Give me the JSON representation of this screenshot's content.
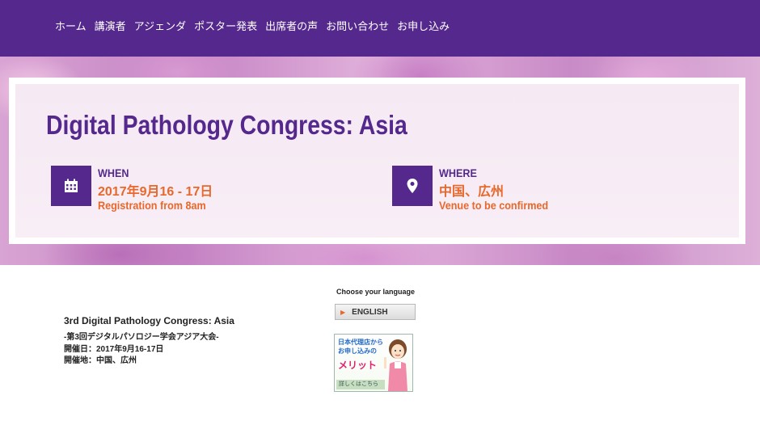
{
  "nav": {
    "items": [
      {
        "label": "ホーム"
      },
      {
        "label": "講演者"
      },
      {
        "label": "アジェンダ"
      },
      {
        "label": "ポスター発表"
      },
      {
        "label": "出席者の声"
      },
      {
        "label": "お問い合わせ"
      },
      {
        "label": "お申し込み"
      }
    ]
  },
  "hero": {
    "title": "Digital Pathology Congress: Asia",
    "when": {
      "label": "WHEN",
      "date": "2017年9月16 - 17日",
      "sub": "Registration from 8am",
      "icon": "calendar-icon"
    },
    "where": {
      "label": "WHERE",
      "place": "中国、広州",
      "sub": "Venue to be confirmed",
      "icon": "map-pin-icon"
    }
  },
  "content": {
    "conference_name": "3rd Digital Pathology Congress: Asia",
    "japanese_name": "-第3回デジタルパソロジー学会アジア大会-",
    "date_line": "開催日：2017年9月16-17日",
    "venue_line": "開催地：中国、広州"
  },
  "language": {
    "prompt": "Choose your language",
    "button_label": "ENGLISH"
  },
  "agent_banner": {
    "line1": "日本代理店から",
    "line2": "お申し込みの",
    "line3": "メリット",
    "more": "詳しくはこちら"
  },
  "colors": {
    "brand_purple": "#54288c",
    "accent_orange": "#e8682b"
  }
}
